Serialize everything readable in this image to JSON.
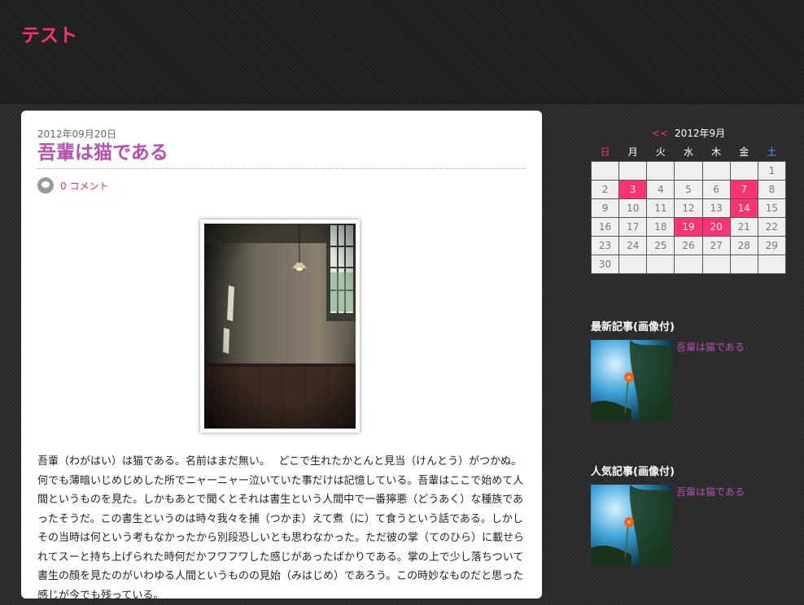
{
  "site": {
    "title": "テスト"
  },
  "post": {
    "date": "2012年09月20日",
    "title": "吾輩は猫である",
    "comments": "0 コメント",
    "body": "吾輩（わがはい）は猫である。名前はまだ無い。　 どこで生れたかとんと見当（けんとう）がつかぬ。何でも薄暗いじめじめした所でニャーニャー泣いていた事だけは記憶している。吾輩はここで始めて人間というものを見た。しかもあとで聞くとそれは書生という人間中で一番獰悪（どうあく）な種族であったそうだ。この書生というのは時々我々を捕（つかま）えて煮（に）て食うという話である。しかしその当時は何という考もなかったから別段恐しいとも思わなかった。ただ彼の掌（てのひら）に載せられてスーと持ち上げられた時何だかフワフワした感じがあったばかりである。掌の上で少し落ちついて書生の顔を見たのがいわゆる人間というものの見始（みはじめ）であろう。この時妙なものだと思った感じが今でも残っている。"
  },
  "calendar": {
    "prev_label": "<<",
    "month_label": "2012年9月",
    "weekdays": [
      "日",
      "月",
      "火",
      "水",
      "木",
      "金",
      "土"
    ],
    "highlight_days": [
      3,
      7,
      14,
      19,
      20
    ],
    "weeks": [
      [
        "",
        "",
        "",
        "",
        "",
        "",
        "1"
      ],
      [
        "2",
        "3",
        "4",
        "5",
        "6",
        "7",
        "8"
      ],
      [
        "9",
        "10",
        "11",
        "12",
        "13",
        "14",
        "15"
      ],
      [
        "16",
        "17",
        "18",
        "19",
        "20",
        "21",
        "22"
      ],
      [
        "23",
        "24",
        "25",
        "26",
        "27",
        "28",
        "29"
      ],
      [
        "30",
        "",
        "",
        "",
        "",
        "",
        ""
      ]
    ]
  },
  "widgets": {
    "latest": {
      "title": "最新記事(画像付)",
      "link": "吾輩は猫である"
    },
    "popular": {
      "title": "人気記事(画像付)",
      "link": "吾輩は猫である"
    }
  },
  "colors": {
    "accent": "#ff3366",
    "post_title": "#b84fb0",
    "calendar_highlight": "#ff3370"
  }
}
